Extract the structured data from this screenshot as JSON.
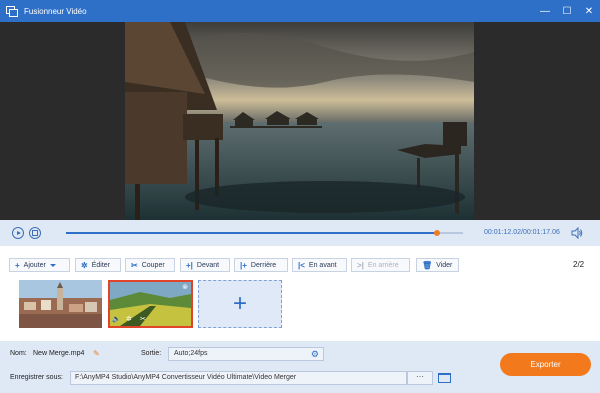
{
  "window": {
    "title": "Fusionneur Vidéo",
    "buttons": {
      "minimize": "—",
      "maximize": "☐",
      "close": "✕"
    }
  },
  "player": {
    "time_current": "00:01:12.02",
    "time_total": "00:01:17.06",
    "progress": 0.935
  },
  "toolbar": {
    "add_label": "Ajouter",
    "edit_label": "Éditer",
    "cut_label": "Couper",
    "front_label": "Devant",
    "behind_label": "Derrière",
    "forward_label": "En avant",
    "backward_label": "En arrière",
    "clear_label": "Vider",
    "page_count": "2/2"
  },
  "clips": [
    {
      "name": "clip-city",
      "selected": false
    },
    {
      "name": "clip-field",
      "selected": true
    }
  ],
  "bottom": {
    "name_label": "Nom:",
    "name_value": "New Merge.mp4",
    "output_label": "Sortie:",
    "output_value": "Auto;24fps",
    "save_label": "Enregistrer sous:",
    "save_path": "F:\\AnyMP4 Studio\\AnyMP4 Convertisseur Vidéo Ultimate\\Video Merger",
    "browse_label": "···",
    "export_label": "Exporter"
  },
  "colors": {
    "titlebar": "#2e6fc7",
    "accent": "#2e6fc7",
    "export": "#f27a1d",
    "selected_border": "#e0452b"
  }
}
